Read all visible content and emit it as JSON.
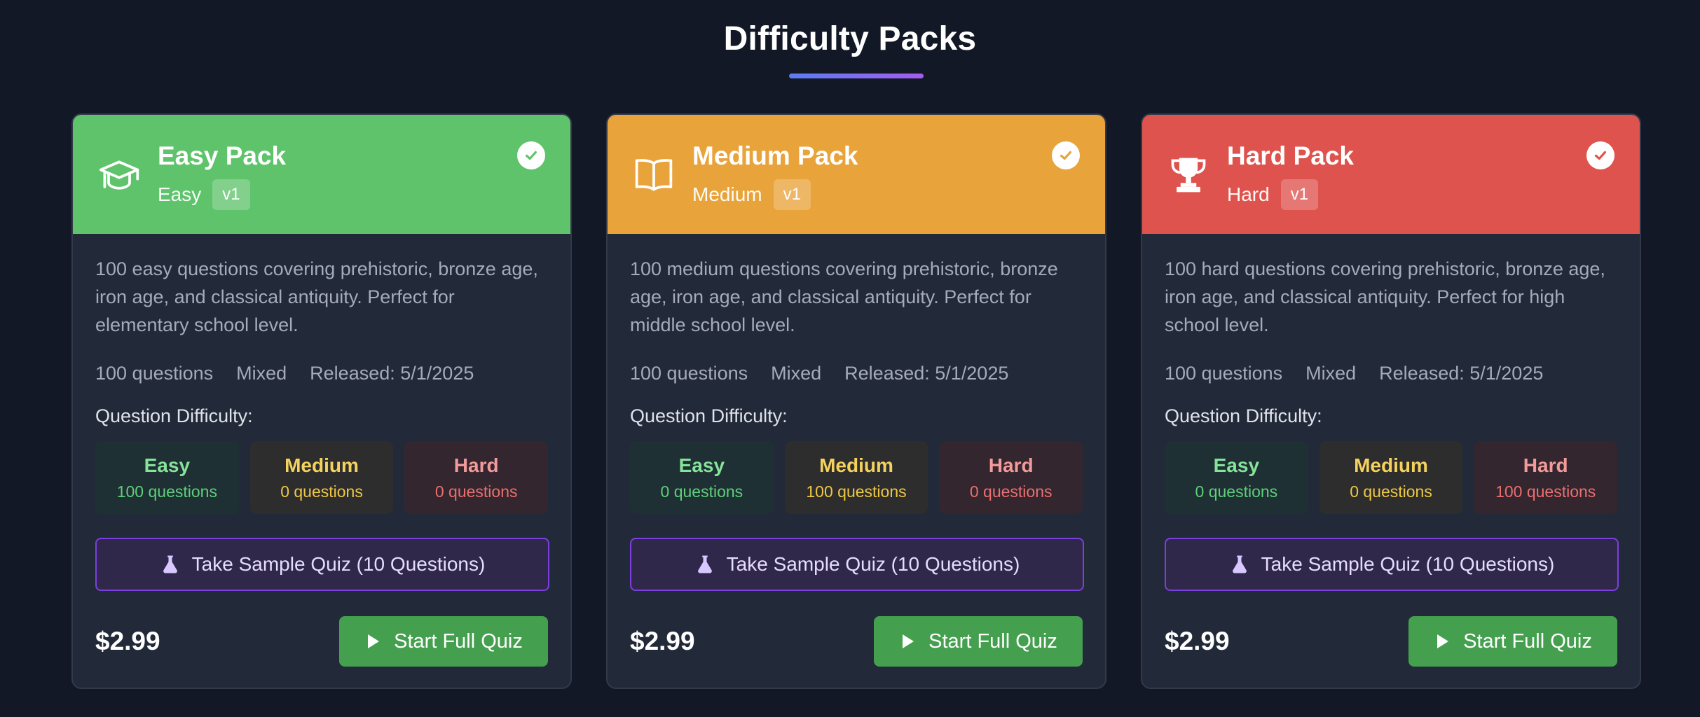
{
  "page": {
    "title": "Difficulty Packs"
  },
  "colors": {
    "background": "#121826",
    "card": "#222938",
    "easy_header": "#5fc36c",
    "medium_header": "#e9a33b",
    "hard_header": "#de534d",
    "sample_border": "#7c3fe0",
    "start_button": "#44a04e"
  },
  "cards": [
    {
      "name": "Easy Pack",
      "level": "Easy",
      "version": "v1",
      "icon": "graduation-cap-icon",
      "header_color": "#5fc36c",
      "check_color": "#5fc36c",
      "description": "100 easy questions covering prehistoric, bronze age, iron age, and classical antiquity. Perfect for elementary school level.",
      "meta": {
        "questions": "100 questions",
        "type": "Mixed",
        "released": "Released: 5/1/2025"
      },
      "difficulty_label": "Question Difficulty:",
      "difficulty": {
        "easy": {
          "label": "Easy",
          "count": "100 questions"
        },
        "medium": {
          "label": "Medium",
          "count": "0 questions"
        },
        "hard": {
          "label": "Hard",
          "count": "0 questions"
        }
      },
      "sample_label": "Take Sample Quiz (10 Questions)",
      "price": "$2.99",
      "start_label": "Start Full Quiz"
    },
    {
      "name": "Medium Pack",
      "level": "Medium",
      "version": "v1",
      "icon": "book-open-icon",
      "header_color": "#e9a33b",
      "check_color": "#e9a33b",
      "description": "100 medium questions covering prehistoric, bronze age, iron age, and classical antiquity. Perfect for middle school level.",
      "meta": {
        "questions": "100 questions",
        "type": "Mixed",
        "released": "Released: 5/1/2025"
      },
      "difficulty_label": "Question Difficulty:",
      "difficulty": {
        "easy": {
          "label": "Easy",
          "count": "0 questions"
        },
        "medium": {
          "label": "Medium",
          "count": "100 questions"
        },
        "hard": {
          "label": "Hard",
          "count": "0 questions"
        }
      },
      "sample_label": "Take Sample Quiz (10 Questions)",
      "price": "$2.99",
      "start_label": "Start Full Quiz"
    },
    {
      "name": "Hard Pack",
      "level": "Hard",
      "version": "v1",
      "icon": "trophy-icon",
      "header_color": "#de534d",
      "check_color": "#de534d",
      "description": "100 hard questions covering prehistoric, bronze age, iron age, and classical antiquity. Perfect for high school level.",
      "meta": {
        "questions": "100 questions",
        "type": "Mixed",
        "released": "Released: 5/1/2025"
      },
      "difficulty_label": "Question Difficulty:",
      "difficulty": {
        "easy": {
          "label": "Easy",
          "count": "0 questions"
        },
        "medium": {
          "label": "Medium",
          "count": "0 questions"
        },
        "hard": {
          "label": "Hard",
          "count": "100 questions"
        }
      },
      "sample_label": "Take Sample Quiz (10 Questions)",
      "price": "$2.99",
      "start_label": "Start Full Quiz"
    }
  ]
}
